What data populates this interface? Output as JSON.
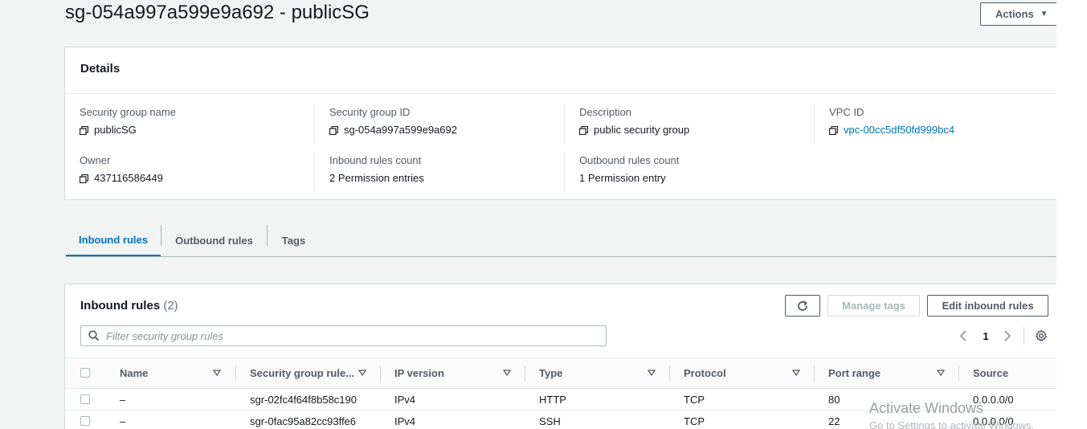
{
  "page": {
    "title": "sg-054a997a599e9a692 - publicSG"
  },
  "actions": {
    "label": "Actions"
  },
  "details": {
    "title": "Details",
    "fields": [
      {
        "label": "Security group name",
        "value": "publicSG"
      },
      {
        "label": "Security group ID",
        "value": "sg-054a997a599e9a692"
      },
      {
        "label": "Description",
        "value": "public security group"
      },
      {
        "label": "VPC ID",
        "value": "vpc-00cc5df50fd999bc4"
      },
      {
        "label": "Owner",
        "value": "437116586449"
      },
      {
        "label": "Inbound rules count",
        "value": "2 Permission entries"
      },
      {
        "label": "Outbound rules count",
        "value": "1 Permission entry"
      }
    ]
  },
  "tabs": [
    "Inbound rules",
    "Outbound rules",
    "Tags"
  ],
  "inbound": {
    "title": "Inbound rules",
    "count": "(2)",
    "manage_tags": "Manage tags",
    "edit_rules": "Edit inbound rules",
    "filter_placeholder": "Filter security group rules",
    "page": "1",
    "columns": [
      "Name",
      "Security group rule...",
      "IP version",
      "Type",
      "Protocol",
      "Port range",
      "Source"
    ],
    "rows": [
      {
        "name": "–",
        "rule_id": "sgr-02fc4f64f8b58c190",
        "ip_version": "IPv4",
        "type": "HTTP",
        "protocol": "TCP",
        "port_range": "80",
        "source": "0.0.0.0/0"
      },
      {
        "name": "–",
        "rule_id": "sgr-0fac95a82cc93ffe6",
        "ip_version": "IPv4",
        "type": "SSH",
        "protocol": "TCP",
        "port_range": "22",
        "source": "0.0.0.0/0"
      }
    ]
  },
  "watermark": {
    "line1": "Activate Windows",
    "line2": "Go to Settings to activate Windows."
  }
}
